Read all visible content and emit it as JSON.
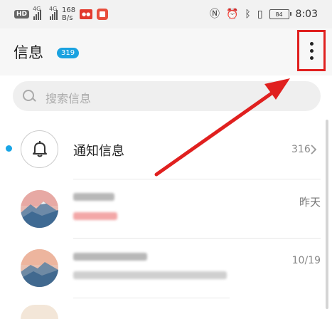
{
  "status_bar": {
    "hd_label": "HD",
    "net_type_1": "4G",
    "net_type_2": "4G",
    "speed_value": "168",
    "speed_unit": "B/s",
    "battery": "84",
    "time": "8:03"
  },
  "header": {
    "title": "信息",
    "unread_count": "319"
  },
  "search": {
    "placeholder": "搜索信息"
  },
  "notification_row": {
    "name": "通知信息",
    "count": "316"
  },
  "conversations": [
    {
      "date": "昨天"
    },
    {
      "date": "10/19"
    }
  ],
  "colors": {
    "accent": "#1aa2e0",
    "annotation_red": "#e0201f"
  }
}
